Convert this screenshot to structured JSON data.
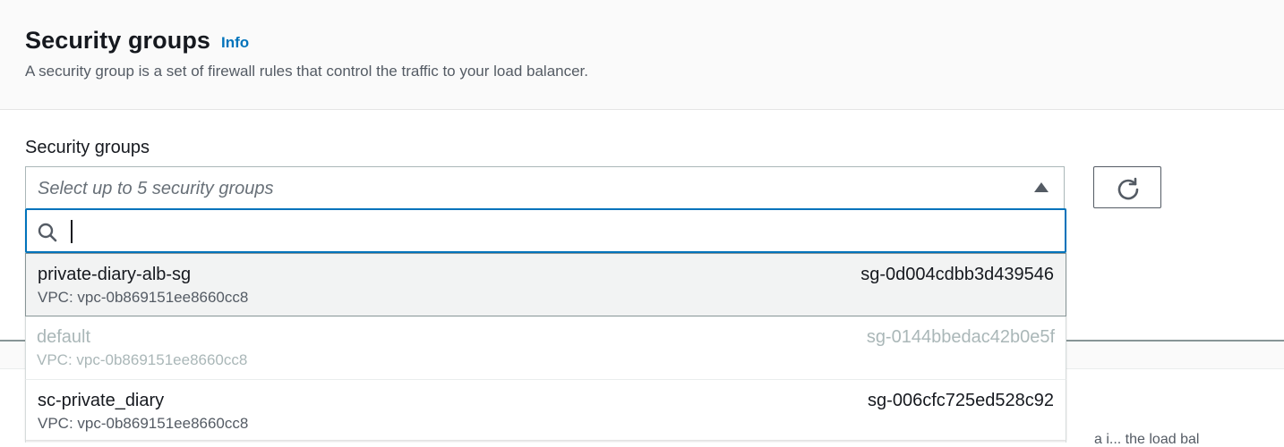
{
  "section": {
    "title": "Security groups",
    "info_label": "Info",
    "description": "A security group is a set of firewall rules that control the traffic to your load balancer."
  },
  "field": {
    "label": "Security groups",
    "placeholder": "Select up to 5 security groups",
    "filter_value": ""
  },
  "options": [
    {
      "name": "private-diary-alb-sg",
      "id": "sg-0d004cdbb3d439546",
      "vpc": "VPC: vpc-0b869151ee8660cc8",
      "state": "highlighted"
    },
    {
      "name": "default",
      "id": "sg-0144bbedac42b0e5f",
      "vpc": "VPC: vpc-0b869151ee8660cc8",
      "state": "disabled"
    },
    {
      "name": "sc-private_diary",
      "id": "sg-006cfc725ed528c92",
      "vpc": "VPC: vpc-0b869151ee8660cc8",
      "state": "normal"
    }
  ],
  "partial_text": "a i... the load bal",
  "icons": {
    "caret": "caret-up-icon",
    "refresh": "refresh-icon",
    "search": "search-icon"
  },
  "colors": {
    "accent": "#0073bb",
    "highlight_bg": "#f2f3f3",
    "disabled_text": "#aab7b8"
  }
}
